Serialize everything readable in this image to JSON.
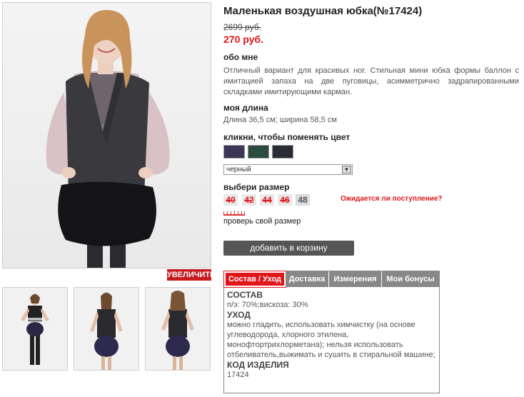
{
  "product": {
    "title": "Маленькая воздушная юбка(№17424)",
    "old_price": "2699 руб.",
    "new_price": "270 руб."
  },
  "about": {
    "heading": "обо мне",
    "text": "Отличный вариант для красивых ног. Стильная мини юбка формы баллон с имитацией запаха на две пуговицы, асимметрично задрапированными складками имитирующими карман."
  },
  "length": {
    "heading": "моя длина",
    "text": "Длина 36,5 см; ширина 58,5 см"
  },
  "color": {
    "heading": "кликни, чтобы поменять цвет",
    "swatches": [
      {
        "name": "purple",
        "hex": "#3b3656"
      },
      {
        "name": "green",
        "hex": "#2d4a3e"
      },
      {
        "name": "black",
        "hex": "#2a2c35"
      }
    ],
    "selected": "черный",
    "dropdown_arrow": "▼"
  },
  "size": {
    "heading": "выбери размер",
    "sizes": [
      {
        "label": "40",
        "available": false
      },
      {
        "label": "42",
        "available": false
      },
      {
        "label": "44",
        "available": false
      },
      {
        "label": "46",
        "available": false
      },
      {
        "label": "48",
        "available": true
      }
    ],
    "expect_link": "Ожидается ли поступление?",
    "check_size": "проверь свой размер"
  },
  "cart_button": "добавить в корзину",
  "zoom_button": "УВЕЛИЧИТЬ",
  "tabs": [
    {
      "label": "Состав / Уход",
      "active": true
    },
    {
      "label": "Доставка",
      "active": false
    },
    {
      "label": "Измерения",
      "active": false
    },
    {
      "label": "Мои бонусы",
      "active": false
    }
  ],
  "tab_content": {
    "composition_heading": "СОСТАВ",
    "composition": "п/э: 70%;вискоза: 30%",
    "care_heading": "УХОД",
    "care": "можно гладить, использовать химчистку (на основе углеводорода, хлорного этилена, монофтортрихлорметана); нельзя использовать отбеливатель,выжимать и сушить в стиральной машине;",
    "code_heading": "КОД ИЗДЕЛИЯ",
    "code": "17424"
  }
}
